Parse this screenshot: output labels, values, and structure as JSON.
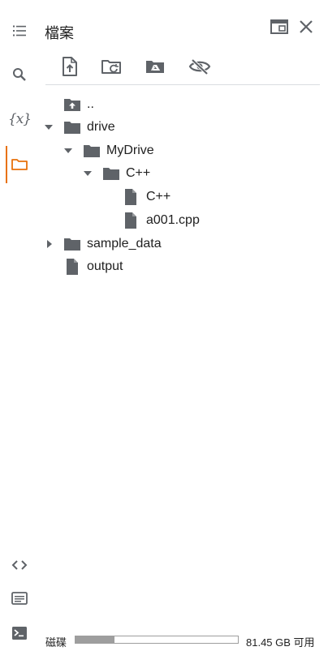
{
  "panel": {
    "title": "檔案"
  },
  "toolbar": {
    "upload": "upload-file-icon",
    "refresh": "refresh-folder-icon",
    "mount_drive": "google-drive-folder-icon",
    "toggle_hidden": "eye-off-icon"
  },
  "rail": {
    "items": [
      "table-of-contents-icon",
      "search-icon",
      "variables-icon",
      "files-icon"
    ],
    "bottom_items": [
      "code-snippets-icon",
      "command-palette-icon",
      "terminal-icon"
    ],
    "variables_glyph": "{x}",
    "active_color": "#e8710a"
  },
  "tree": {
    "items": [
      {
        "label": "..",
        "type": "parent-folder",
        "depth": 0,
        "expanded": null
      },
      {
        "label": "drive",
        "type": "folder",
        "depth": 0,
        "expanded": true
      },
      {
        "label": "MyDrive",
        "type": "folder",
        "depth": 1,
        "expanded": true
      },
      {
        "label": "C++",
        "type": "folder",
        "depth": 2,
        "expanded": true
      },
      {
        "label": "C++",
        "type": "file",
        "depth": 3,
        "expanded": null
      },
      {
        "label": "a001.cpp",
        "type": "file",
        "depth": 3,
        "expanded": null
      },
      {
        "label": "sample_data",
        "type": "folder",
        "depth": 0,
        "expanded": false
      },
      {
        "label": "output",
        "type": "file",
        "depth": 0,
        "expanded": null
      }
    ]
  },
  "footer": {
    "disk_label": "磁碟",
    "disk_used_fraction": 0.24,
    "disk_free_text": "81.45 GB 可用"
  },
  "colors": {
    "icon": "#5f6368",
    "active": "#e8710a",
    "divider": "#dadce0"
  }
}
